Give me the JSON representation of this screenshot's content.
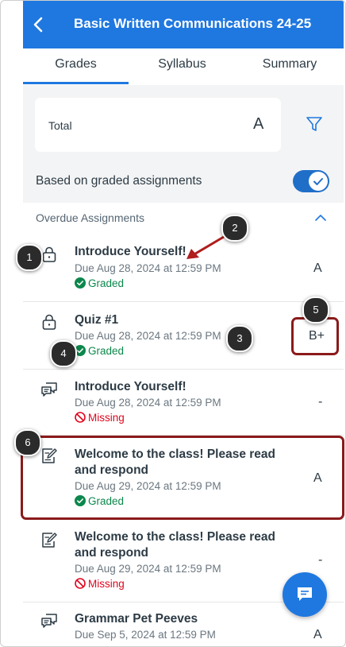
{
  "header": {
    "title": "Basic Written Communications 24-25"
  },
  "tabs": [
    {
      "label": "Grades"
    },
    {
      "label": "Syllabus"
    },
    {
      "label": "Summary"
    }
  ],
  "total": {
    "label": "Total",
    "value": "A"
  },
  "based_on": {
    "label": "Based on graded assignments",
    "toggle_on": true
  },
  "section": {
    "title": "Overdue Assignments"
  },
  "assignments": [
    {
      "name": "Introduce Yourself!",
      "due": "Due Aug 28, 2024 at 12:59 PM",
      "status": "Graded",
      "grade": "A",
      "icon": "lock-icon"
    },
    {
      "name": "Quiz #1",
      "due": "Due Aug 28, 2024 at 12:59 PM",
      "status": "Graded",
      "grade": "B+",
      "icon": "lock-icon"
    },
    {
      "name": "Introduce Yourself!",
      "due": "Due Aug 28, 2024 at 12:59 PM",
      "status": "Missing",
      "grade": "-",
      "icon": "discussion-icon"
    },
    {
      "name": "Welcome to the class! Please read and respond",
      "due": "Due Aug 29, 2024 at 12:59 PM",
      "status": "Graded",
      "grade": "A",
      "icon": "assignment-icon"
    },
    {
      "name": "Welcome to the class! Please read and respond",
      "due": "Due Aug 29, 2024 at 12:59 PM",
      "status": "Missing",
      "grade": "-",
      "icon": "assignment-icon"
    },
    {
      "name": "Grammar Pet Peeves",
      "due": "Due Sep 5, 2024 at 12:59 PM",
      "status": "",
      "grade": "A",
      "icon": "discussion-icon"
    }
  ],
  "callouts": [
    "1",
    "2",
    "3",
    "4",
    "5",
    "6"
  ],
  "colors": {
    "brand": "#1f78e0",
    "graded": "#0b874b",
    "missing": "#e0061f",
    "annotation": "#8b1a1a"
  }
}
